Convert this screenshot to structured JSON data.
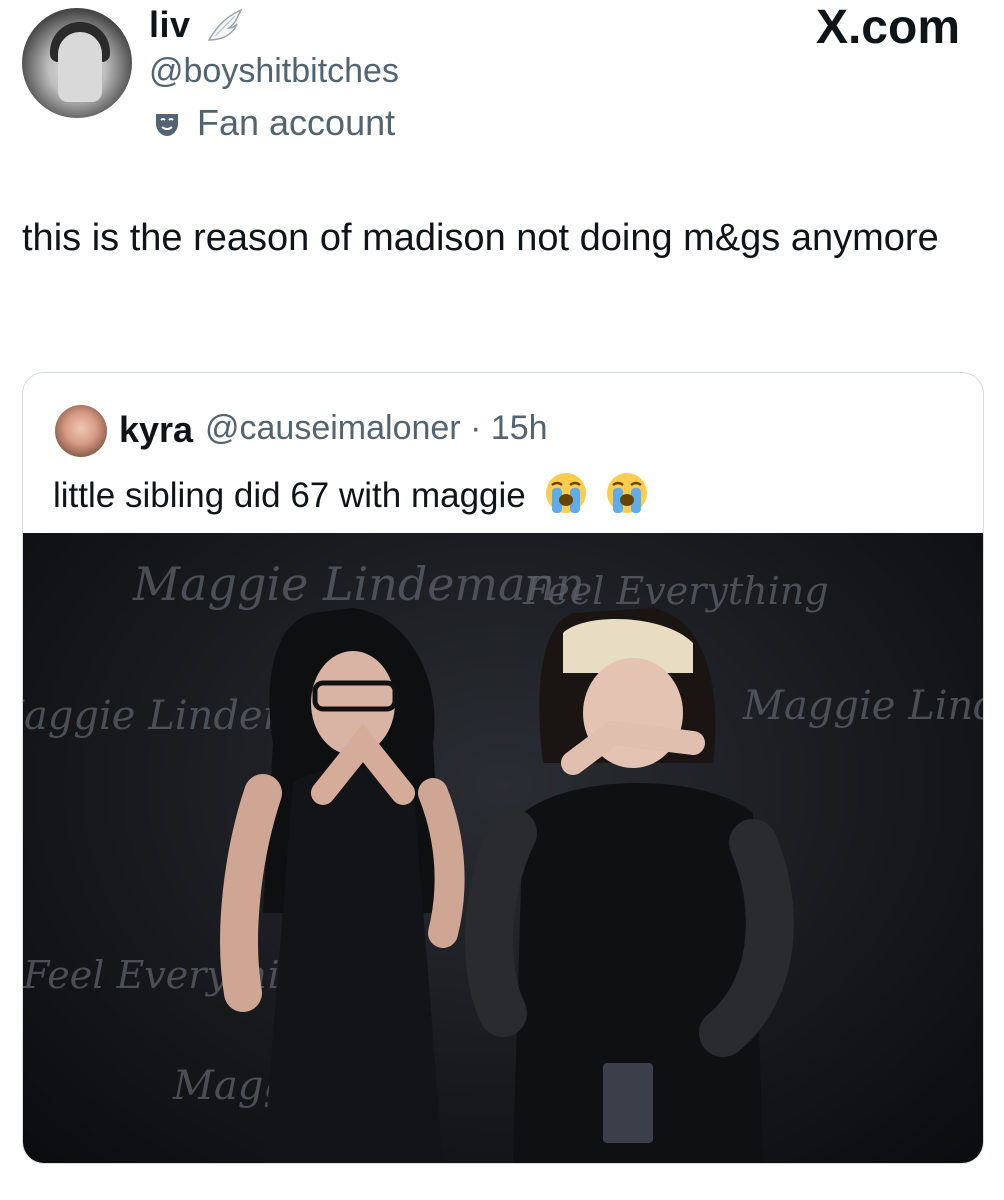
{
  "header": {
    "display_name": "liv",
    "handle": "@boyshitbitches",
    "fan_label": "Fan account",
    "site": "X.com"
  },
  "post": {
    "text": "this is the reason of madison not doing m&gs anymore"
  },
  "quote": {
    "name": "kyra",
    "handle_time": "@causeimaloner · 15h",
    "text": "little sibling did 67 with maggie"
  },
  "photo_backdrop": [
    "Maggie Lindemann",
    "Feel Everything",
    "Maggie Lindemann",
    "Maggie Lindemann",
    "Feel Everything",
    "Magg"
  ],
  "icons": [
    "wing-icon",
    "fan-mask-icon",
    "loudly-crying-face-icon"
  ],
  "colors": {
    "text": "#0f1419",
    "secondary": "#536471",
    "border": "#d6dbdf"
  }
}
